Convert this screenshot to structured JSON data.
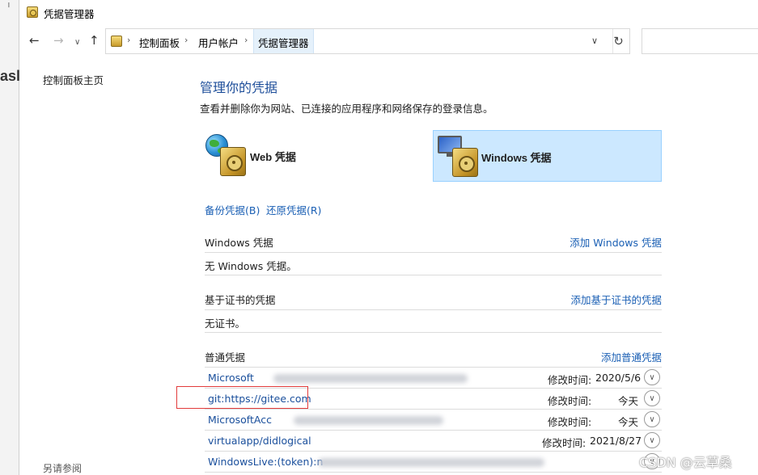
{
  "window": {
    "title": "凭据管理器"
  },
  "background_window": {
    "fragment": "asl",
    "top_fragment": "ᅵ"
  },
  "nav": {
    "breadcrumbs": [
      "控制面板",
      "用户帐户",
      "凭据管理器"
    ]
  },
  "sidebar": {
    "home": "控制面板主页",
    "see_also": "另请参阅"
  },
  "main": {
    "title": "管理你的凭据",
    "description": "查看并删除你为网站、已连接的应用程序和网络保存的登录信息。",
    "tiles": [
      {
        "label": "Web 凭据",
        "icon": "web-credential-icon",
        "selected": false
      },
      {
        "label": "Windows 凭据",
        "icon": "windows-credential-icon",
        "selected": true
      }
    ],
    "backup_label": "备份凭据(B)",
    "restore_label": "还原凭据(R)",
    "sections": {
      "windows": {
        "title": "Windows 凭据",
        "add": "添加 Windows 凭据",
        "empty": "无 Windows 凭据。"
      },
      "certificate": {
        "title": "基于证书的凭据",
        "add": "添加基于证书的凭据",
        "empty": "无证书。"
      },
      "generic": {
        "title": "普通凭据",
        "add": "添加普通凭据"
      }
    },
    "generic_credentials": [
      {
        "name": "Microsoft",
        "modified_label": "修改时间:",
        "modified": "2020/5/6"
      },
      {
        "name": "git:https://gitee.com",
        "modified_label": "修改时间:",
        "modified": "今天"
      },
      {
        "name": "MicrosoftAcc",
        "modified_label": "修改时间:",
        "modified": "今天"
      },
      {
        "name": "virtualapp/didlogical",
        "modified_label": "修改时间:",
        "modified": "2021/8/27"
      },
      {
        "name": "WindowsLive:(token):n",
        "modified_label": "",
        "modified": ""
      }
    ]
  },
  "watermark": "CSDN @云草桑",
  "colors": {
    "accent_link": "#1a5fb4",
    "title_blue": "#1e4e9a",
    "selected_tile": "#cce8ff",
    "highlight": "#e23b3b"
  }
}
